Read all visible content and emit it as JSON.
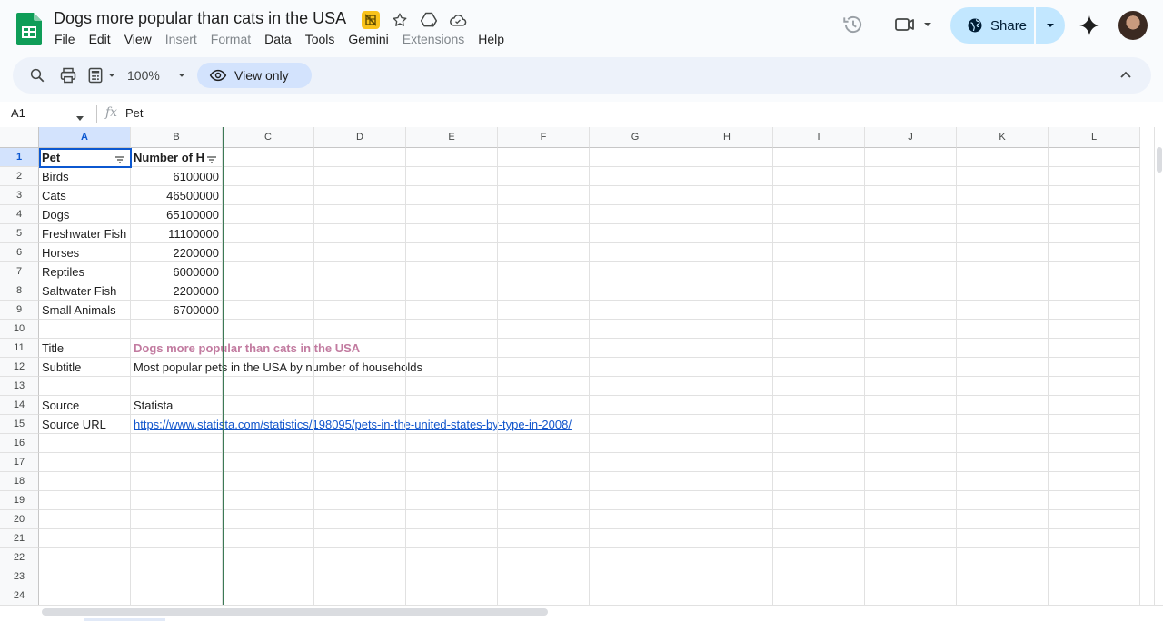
{
  "app": {
    "doc_title": "Dogs more popular than cats in the USA"
  },
  "menu": [
    "File",
    "Edit",
    "View",
    "Insert",
    "Format",
    "Data",
    "Tools",
    "Gemini",
    "Extensions",
    "Help"
  ],
  "menu_disabled": [
    "Insert",
    "Format",
    "Extensions"
  ],
  "header": {
    "share_label": "Share"
  },
  "toolbar": {
    "zoom": "100%",
    "view_only_label": "View only"
  },
  "formula_bar": {
    "name_box": "A1",
    "fx_label": "fx",
    "value": "Pet"
  },
  "columns": [
    "A",
    "B",
    "C",
    "D",
    "E",
    "F",
    "G",
    "H",
    "I",
    "J",
    "K",
    "L"
  ],
  "rows": [
    "1",
    "2",
    "3",
    "4",
    "5",
    "6",
    "7",
    "8",
    "9",
    "10",
    "11",
    "12",
    "13",
    "14",
    "15",
    "16",
    "17",
    "18",
    "19",
    "20",
    "21",
    "22",
    "23",
    "24"
  ],
  "sheet": {
    "header": [
      "Pet",
      "Number of H"
    ],
    "data": [
      [
        "Birds",
        "6100000"
      ],
      [
        "Cats",
        "46500000"
      ],
      [
        "Dogs",
        "65100000"
      ],
      [
        "Freshwater Fish",
        "11100000"
      ],
      [
        "Horses",
        "2200000"
      ],
      [
        "Reptiles",
        "6000000"
      ],
      [
        "Saltwater Fish",
        "2200000"
      ],
      [
        "Small Animals",
        "6700000"
      ]
    ],
    "meta": {
      "title_label": "Title",
      "title_value": "Dogs more popular than cats in the USA",
      "subtitle_label": "Subtitle",
      "subtitle_value": "Most popular pets in the USA by number of households",
      "source_label": "Source",
      "source_value": "Statista",
      "source_url_label": "Source URL",
      "source_url_value": "https://www.statista.com/statistics/198095/pets-in-the-united-states-by-type-in-2008/"
    }
  },
  "colors": {
    "accent": "#0b57d0",
    "share_bg": "#c2e7ff",
    "title_text": "#c27ba0",
    "link": "#1155cc",
    "sheets_green": "#0f9d58"
  }
}
